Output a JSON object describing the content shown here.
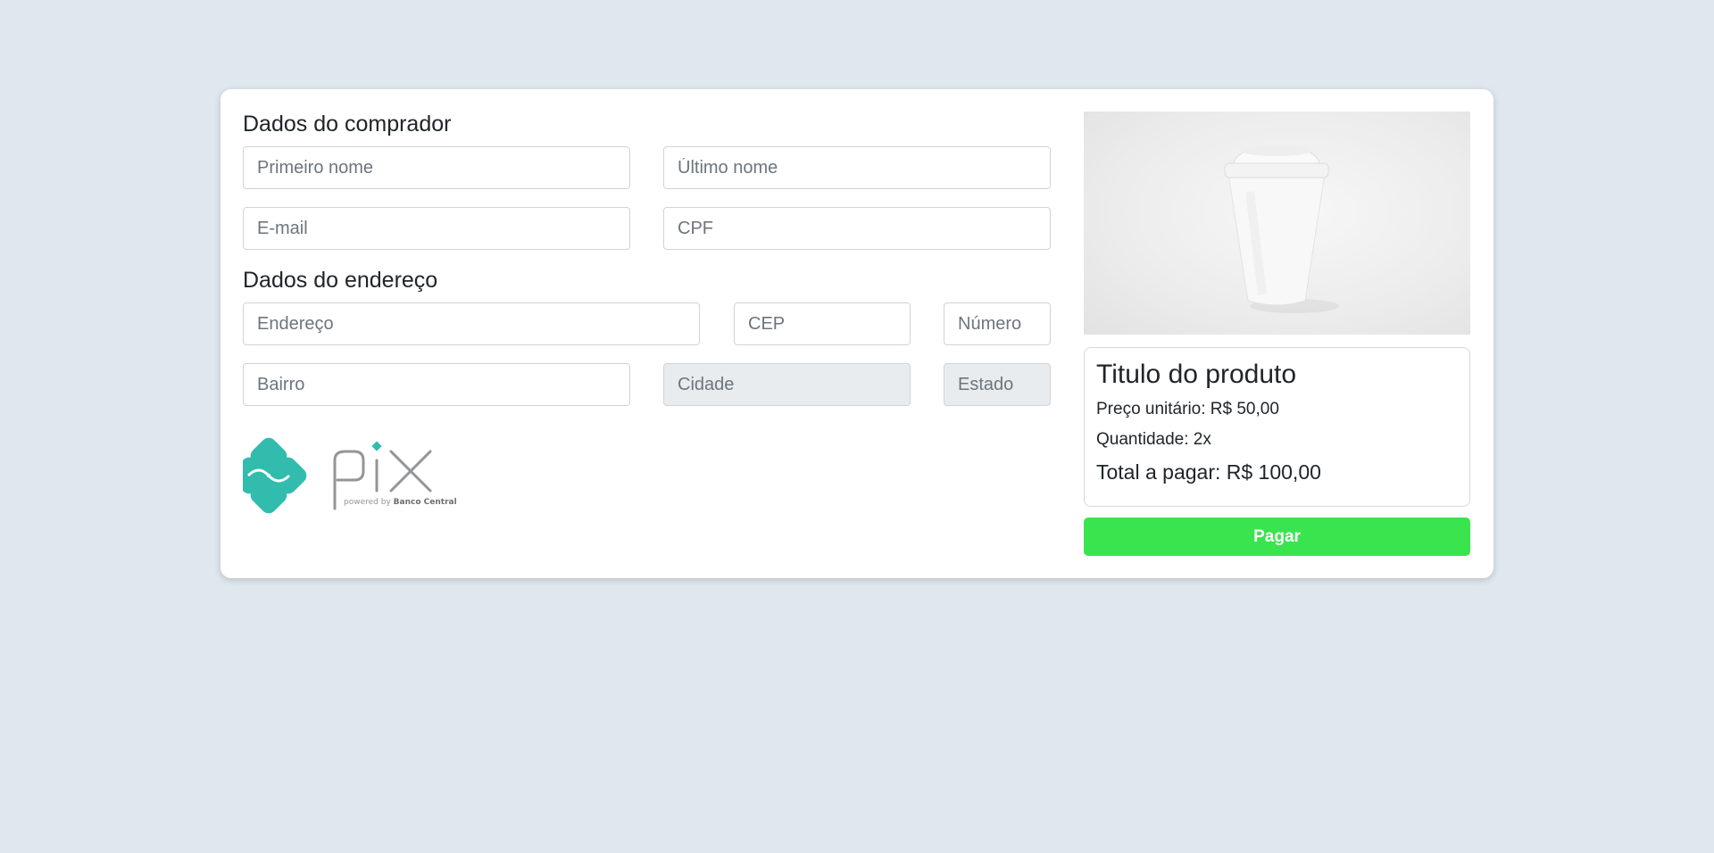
{
  "buyer": {
    "title": "Dados do comprador",
    "first_name_placeholder": "Primeiro nome",
    "last_name_placeholder": "Último nome",
    "email_placeholder": "E-mail",
    "cpf_placeholder": "CPF"
  },
  "address": {
    "title": "Dados do endereço",
    "street_placeholder": "Endereço",
    "cep_placeholder": "CEP",
    "number_placeholder": "Número",
    "neighborhood_placeholder": "Bairro",
    "city_placeholder": "Cidade",
    "state_placeholder": "Estado"
  },
  "logo": {
    "word": "pix",
    "tagline_prefix": "powered by",
    "tagline_brand": "Banco Central",
    "colors": {
      "mark": "#32bcad",
      "word": "#939598"
    }
  },
  "product": {
    "title": "Titulo do produto",
    "unit_price": "Preço unitário: R$ 50,00",
    "quantity": "Quantidade: 2x",
    "total": "Total a pagar: R$ 100,00"
  },
  "actions": {
    "pay_label": "Pagar"
  },
  "colors": {
    "background": "#dfe8ee",
    "pay_button": "#3ae44f"
  }
}
